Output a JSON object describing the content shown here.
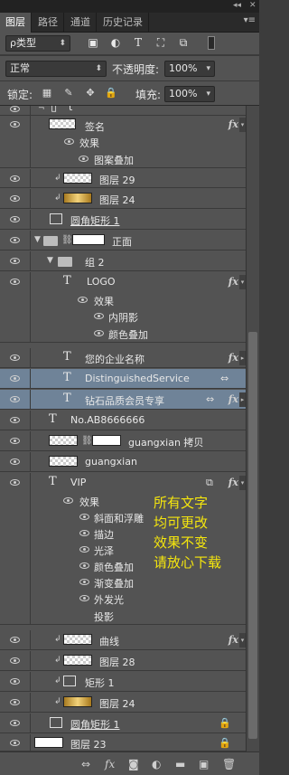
{
  "panel": {
    "tabs": [
      "图层",
      "路径",
      "通道",
      "历史记录"
    ],
    "window_controls": {
      "collapse": "◂◂",
      "close": "✕"
    },
    "menu_icon": "▾≡"
  },
  "filter": {
    "type_label": "ρ类型",
    "icons": [
      "image-filter-icon",
      "adjustment-filter-icon",
      "type-filter-icon",
      "shape-filter-icon",
      "smart-object-filter-icon"
    ]
  },
  "blend": {
    "mode": "正常",
    "opacity_label": "不透明度:",
    "opacity_value": "100%"
  },
  "lock": {
    "label": "锁定:",
    "fill_label": "填充:",
    "fill_value": "100%"
  },
  "layers": [
    {
      "kind": "text",
      "name": "t",
      "vis": true
    },
    {
      "kind": "layer",
      "name": "签名",
      "vis": true,
      "fx": true
    },
    {
      "kind": "fxheader",
      "name": "效果"
    },
    {
      "kind": "effect",
      "name": "图案叠加"
    },
    {
      "kind": "layer",
      "name": "图层 29",
      "vis": true
    },
    {
      "kind": "layer",
      "name": "图层 24",
      "vis": true
    },
    {
      "kind": "shape",
      "name": "圆角矩形 1",
      "vis": true
    },
    {
      "kind": "group",
      "name": "正面",
      "vis": true
    },
    {
      "kind": "group",
      "name": "组 2",
      "vis": true
    },
    {
      "kind": "text",
      "name": "LOGO",
      "vis": true,
      "fx": true
    },
    {
      "kind": "fxheader",
      "name": "效果"
    },
    {
      "kind": "effect",
      "name": "内阴影"
    },
    {
      "kind": "effect",
      "name": "颜色叠加"
    },
    {
      "kind": "text",
      "name": "您的企业名称",
      "vis": true,
      "fx": true
    },
    {
      "kind": "text",
      "name": "DistinguishedService",
      "vis": true,
      "selected": true
    },
    {
      "kind": "text",
      "name": "钻石品质会员专享",
      "vis": true,
      "selected": true,
      "fx": true
    },
    {
      "kind": "text",
      "name": "No.AB8666666",
      "vis": true
    },
    {
      "kind": "layer",
      "name": "guangxian 拷贝",
      "vis": true
    },
    {
      "kind": "layer",
      "name": "guangxian",
      "vis": true
    },
    {
      "kind": "text",
      "name": "VIP",
      "vis": true,
      "fx": true
    },
    {
      "kind": "fxheader",
      "name": "效果"
    },
    {
      "kind": "effect",
      "name": "斜面和浮雕"
    },
    {
      "kind": "effect",
      "name": "描边"
    },
    {
      "kind": "effect",
      "name": "光泽"
    },
    {
      "kind": "effect",
      "name": "颜色叠加"
    },
    {
      "kind": "effect",
      "name": "渐变叠加"
    },
    {
      "kind": "effect",
      "name": "外发光"
    },
    {
      "kind": "effect",
      "name": "投影"
    },
    {
      "kind": "layer",
      "name": "曲线",
      "vis": true,
      "fx": true
    },
    {
      "kind": "layer",
      "name": "图层 28",
      "vis": true
    },
    {
      "kind": "shape",
      "name": "矩形 1",
      "vis": true
    },
    {
      "kind": "layer",
      "name": "图层 24",
      "vis": true
    },
    {
      "kind": "shape",
      "name": "圆角矩形 1",
      "vis": true,
      "locked": true
    },
    {
      "kind": "layer",
      "name": "图层 23",
      "vis": true,
      "locked": true
    }
  ],
  "overlay_lines": [
    "所有文字",
    "均可更改",
    "效果不变",
    "请放心下载"
  ],
  "bottom_icons": [
    "link-icon",
    "fx-icon",
    "mask-icon",
    "adjustment-icon",
    "folder-icon",
    "new-layer-icon",
    "trash-icon"
  ],
  "colors": {
    "panel": "#535353",
    "selected": "#6f8398",
    "overlay_text": "#f5e60d"
  }
}
